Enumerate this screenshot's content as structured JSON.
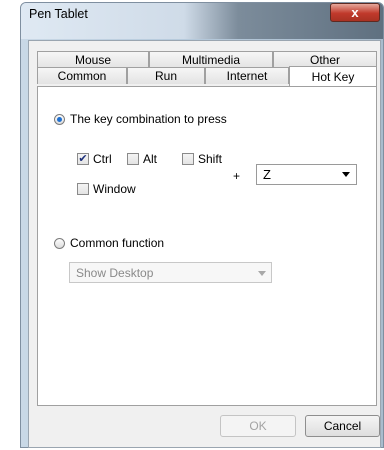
{
  "window": {
    "title": "Pen Tablet",
    "close_glyph": "x"
  },
  "tabs": {
    "back_row": [
      "Mouse",
      "Multimedia",
      "Other"
    ],
    "front_row": [
      "Common",
      "Run",
      "Internet",
      "Hot Key"
    ],
    "active": "Hot Key"
  },
  "hotkey": {
    "key_combo_label": "The key combination to press",
    "key_combo_selected": true,
    "modifiers": [
      {
        "label": "Ctrl",
        "checked": true
      },
      {
        "label": "Alt",
        "checked": false
      },
      {
        "label": "Shift",
        "checked": false
      },
      {
        "label": "Window",
        "checked": false
      }
    ],
    "plus": "+",
    "key_value": "Z",
    "common_function_label": "Common function",
    "common_function_selected": false,
    "common_function_value": "Show Desktop"
  },
  "buttons": {
    "ok": "OK",
    "cancel": "Cancel"
  },
  "colors": {
    "accent": "#1e6fd0",
    "close": "#c0392b"
  }
}
